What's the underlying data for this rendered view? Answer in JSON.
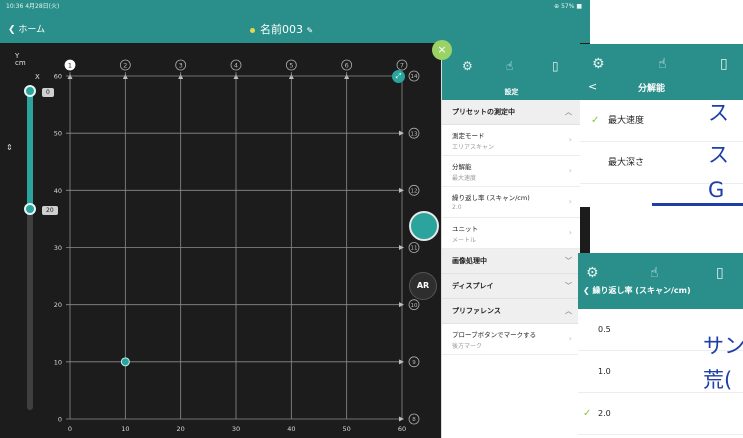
{
  "status_bar": {
    "time": "10:36  4月28日(火)",
    "right": "⊕ 57% ■"
  },
  "nav": {
    "back_label": "ホーム",
    "title": "名前003"
  },
  "slider": {
    "top_value": "0",
    "bottom_value": "20",
    "arrow_glyph": "⇕"
  },
  "grid": {
    "axis_y": "Y",
    "axis_unit": "cm",
    "axis_x": "X",
    "column_markers": [
      "1",
      "2",
      "3",
      "4",
      "5",
      "6",
      "7"
    ],
    "row_markers": [
      "14",
      "13",
      "12",
      "11",
      "10",
      "9",
      "8"
    ],
    "y_ticks": [
      "60",
      "50",
      "40",
      "30",
      "20",
      "10",
      "0"
    ],
    "x_ticks": [
      "0",
      "10",
      "20",
      "30",
      "40",
      "50",
      "60"
    ],
    "marker_point": {
      "x": 10,
      "y": 10
    }
  },
  "fabs": {
    "ar_label": "AR",
    "expand_glyph": "⤢"
  },
  "settings": {
    "title": "設定",
    "close_glyph": "×",
    "tabs": [
      "gear-icon",
      "touch-icon",
      "panel-icon"
    ],
    "sections": [
      {
        "heading": "プリセットの測定中",
        "chevron": "^",
        "rows": [
          {
            "label": "測定モード",
            "value": "エリアスキャン"
          },
          {
            "label": "分解能",
            "value": "最大速度"
          },
          {
            "label": "繰り返し率 (スキャン/cm)",
            "value": "2.0"
          },
          {
            "label": "ユニット",
            "value": "メートル"
          }
        ]
      },
      {
        "heading": "画像処理中",
        "chevron": "v",
        "rows": []
      },
      {
        "heading": "ディスプレイ",
        "chevron": "v",
        "rows": []
      },
      {
        "heading": "プリファレンス",
        "chevron": "^",
        "rows": [
          {
            "label": "プローブボタンでマークする",
            "value": "後方マーク"
          }
        ]
      }
    ]
  },
  "resolution_panel": {
    "title": "分解能",
    "back_glyph": "<",
    "options": [
      {
        "label": "最大速度",
        "selected": true
      },
      {
        "label": "最大深さ",
        "selected": false
      }
    ]
  },
  "reprate_panel": {
    "title": "繰り返し率 (スキャン/cm)",
    "options": [
      {
        "label": "0.5",
        "selected": false
      },
      {
        "label": "1.0",
        "selected": false
      },
      {
        "label": "2.0",
        "selected": true
      }
    ]
  },
  "annotations": {
    "line1": "ス",
    "line2": "ス",
    "line3": "G",
    "line4": "サン",
    "line5": "荒("
  },
  "colors": {
    "accent": "#2a8f8a",
    "accent_light": "#2aa49c",
    "check": "#8cc43a",
    "annotation": "#1f3fa8"
  }
}
